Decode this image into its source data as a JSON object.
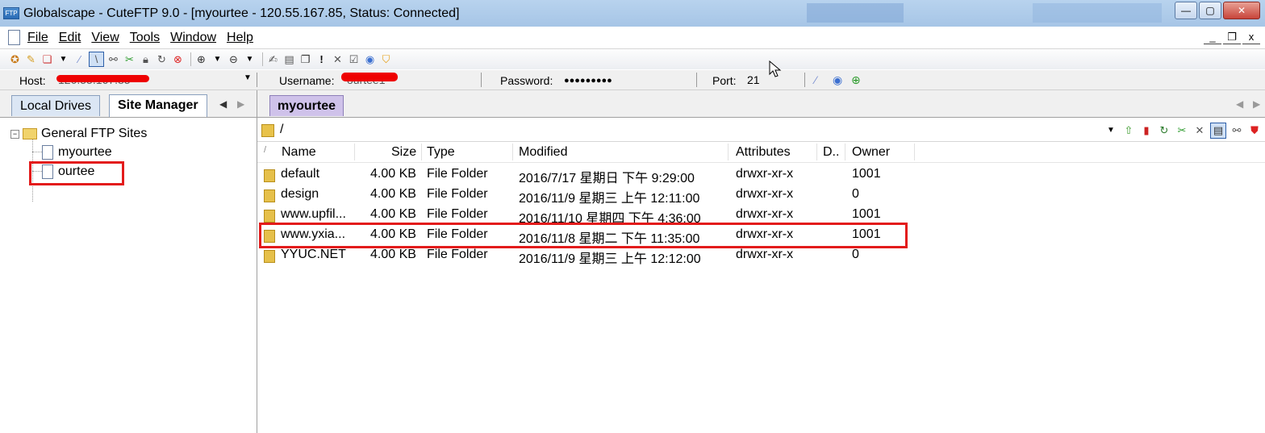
{
  "window": {
    "title": "Globalscape - CuteFTP 9.0 - [myourtee - 120.55.167.85, Status: Connected]",
    "minimize": "—",
    "maximize": "▢",
    "close": "✕"
  },
  "menu": {
    "items": [
      "File",
      "Edit",
      "View",
      "Tools",
      "Window",
      "Help"
    ],
    "mdi_min": "_",
    "mdi_restore": "❐",
    "mdi_close": "x"
  },
  "quick_connect": {
    "host_label": "Host:",
    "host_value": "120.55.167.85",
    "username_label": "Username:",
    "username_value": "ourtee1",
    "password_label": "Password:",
    "password_value": "●●●●●●●●●",
    "port_label": "Port:",
    "port_value": "21"
  },
  "left_panel": {
    "tabs": [
      "Local Drives",
      "Site Manager"
    ],
    "active_tab": "Site Manager",
    "tree": {
      "root": "General FTP Sites",
      "sites": [
        "myourtee",
        "ourtee"
      ]
    }
  },
  "right_panel": {
    "session_tab": "myourtee",
    "path": "/",
    "columns": [
      "Name",
      "Size",
      "Type",
      "Modified",
      "Attributes",
      "D..",
      "Owner"
    ],
    "rows": [
      {
        "name": "default",
        "size": "4.00 KB",
        "type": "File Folder",
        "modified": "2016/7/17 星期日 下午 9:29:00",
        "attributes": "drwxr-xr-x",
        "d": "",
        "owner": "1001"
      },
      {
        "name": "design",
        "size": "4.00 KB",
        "type": "File Folder",
        "modified": "2016/11/9 星期三 上午 12:11:00",
        "attributes": "drwxr-xr-x",
        "d": "",
        "owner": "0"
      },
      {
        "name": "www.upfil...",
        "size": "4.00 KB",
        "type": "File Folder",
        "modified": "2016/11/10 星期四 下午 4:36:00",
        "attributes": "drwxr-xr-x",
        "d": "",
        "owner": "1001"
      },
      {
        "name": "www.yxia...",
        "size": "4.00 KB",
        "type": "File Folder",
        "modified": "2016/11/8 星期二 下午 11:35:00",
        "attributes": "drwxr-xr-x",
        "d": "",
        "owner": "1001"
      },
      {
        "name": "YYUC.NET",
        "size": "4.00 KB",
        "type": "File Folder",
        "modified": "2016/11/9 星期三 上午 12:12:00",
        "attributes": "drwxr-xr-x",
        "d": "",
        "owner": "0"
      }
    ]
  },
  "colors": {
    "titlebar": "#b8d3ee",
    "highlight_red": "#e31b1b",
    "session_tab": "#cfc2ea"
  }
}
